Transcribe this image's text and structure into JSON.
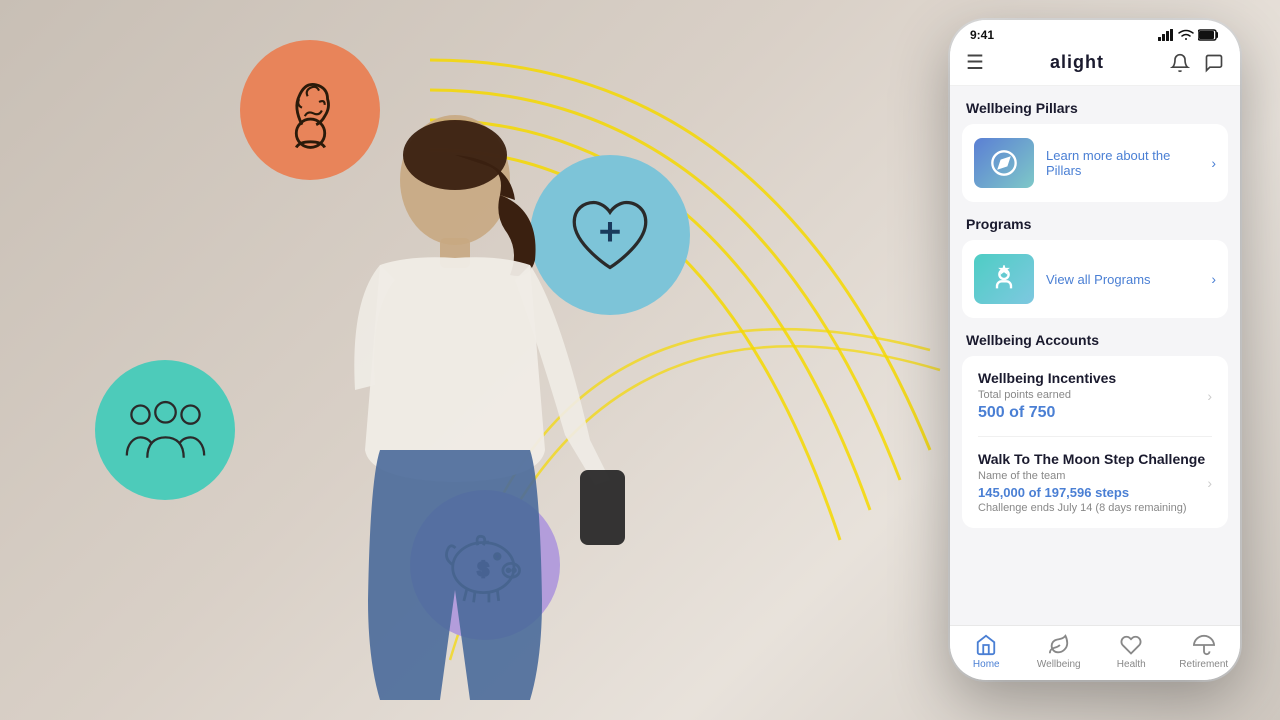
{
  "app": {
    "name": "alight",
    "status_bar": {
      "time": "9:41",
      "signal": "●●●●",
      "wifi": "wifi",
      "battery": "battery"
    }
  },
  "header": {
    "menu_icon": "☰",
    "logo": "alight",
    "bell_icon": "🔔",
    "chat_icon": "💬"
  },
  "sections": {
    "wellbeing_pillars": {
      "title": "Wellbeing Pillars",
      "link": "Learn more about the Pillars"
    },
    "programs": {
      "title": "Programs",
      "link": "View all Programs"
    },
    "wellbeing_accounts": {
      "title": "Wellbeing Accounts",
      "incentives": {
        "title": "Wellbeing Incentives",
        "subtitle": "Total points earned",
        "value": "500 of 750"
      },
      "step_challenge": {
        "title": "Walk To The Moon Step Challenge",
        "subtitle": "Name of the team",
        "value": "145,000 of 197,596 steps",
        "desc": "Challenge ends July 14 (8 days remaining)"
      }
    }
  },
  "nav": {
    "items": [
      {
        "icon": "⌂",
        "label": "Home",
        "active": true
      },
      {
        "icon": "🌿",
        "label": "Wellbeing",
        "active": false
      },
      {
        "icon": "♡",
        "label": "Health",
        "active": false
      },
      {
        "icon": "☂",
        "label": "Retirement",
        "active": false
      }
    ]
  },
  "circles": {
    "brain": {
      "label": "Mental Wellbeing",
      "bg": "#e8845a"
    },
    "health": {
      "label": "Health",
      "bg": "#7dc4d8"
    },
    "team": {
      "label": "Community",
      "bg": "#4dcbba"
    },
    "piggy": {
      "label": "Financial",
      "bg": "#b39ddb"
    }
  }
}
